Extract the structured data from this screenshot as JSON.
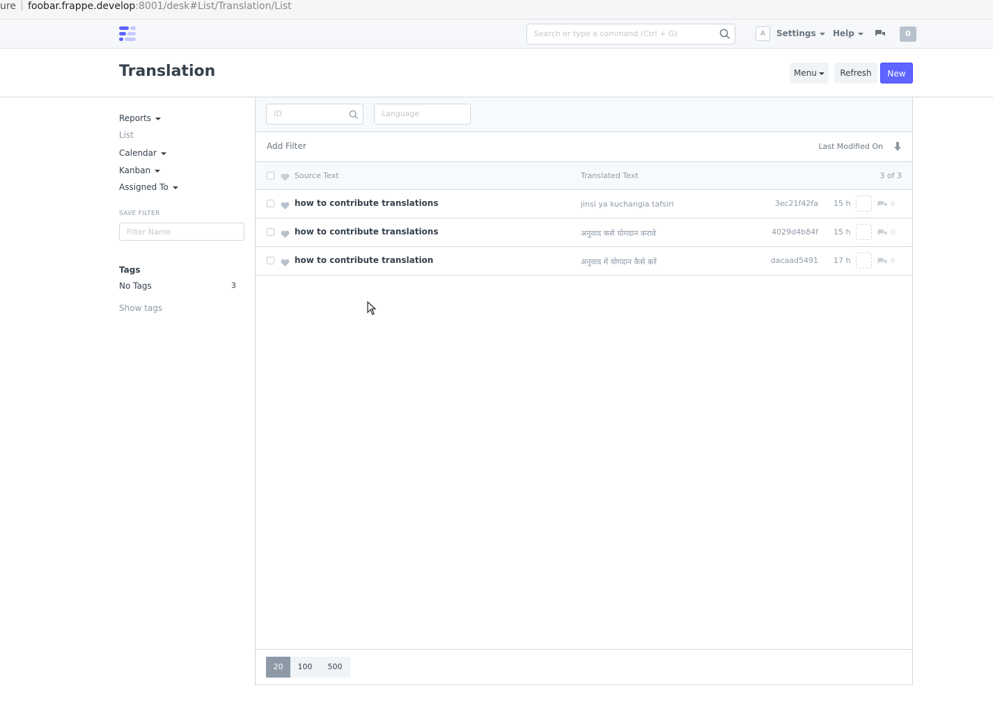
{
  "browser": {
    "url_prefix": "ure",
    "url_host": "foobar.frappe.develop",
    "url_path": ":8001/desk#List/Translation/List"
  },
  "navbar": {
    "search_placeholder": "Search or type a command (Ctrl + G)",
    "avatar_letter": "A",
    "settings_label": "Settings",
    "help_label": "Help",
    "notification_count": "0"
  },
  "page": {
    "title": "Translation",
    "menu_label": "Menu",
    "refresh_label": "Refresh",
    "new_label": "New"
  },
  "sidebar": {
    "items": [
      {
        "label": "Reports",
        "dropdown": true
      },
      {
        "label": "List",
        "dropdown": false
      },
      {
        "label": "Calendar",
        "dropdown": true
      },
      {
        "label": "Kanban",
        "dropdown": true
      },
      {
        "label": "Assigned To",
        "dropdown": true
      }
    ],
    "save_filter_label": "SAVE FILTER",
    "filter_name_placeholder": "Filter Name",
    "tags_heading": "Tags",
    "no_tags_label": "No Tags",
    "no_tags_count": "3",
    "show_tags_label": "Show tags"
  },
  "list": {
    "filters": {
      "id_placeholder": "ID",
      "language_placeholder": "Language"
    },
    "add_filter_label": "Add Filter",
    "sort_label": "Last Modified On",
    "header": {
      "source_text": "Source Text",
      "translated_text": "Translated Text",
      "count": "3 of 3"
    },
    "rows": [
      {
        "source": "how to contribute translations",
        "translated": "jinsi ya kuchangia tafsiri",
        "name": "3ec21f42fa",
        "modified": "15 h",
        "comments": "0"
      },
      {
        "source": "how to contribute translations",
        "translated": "अनुवाद कसे योगदान करावे",
        "name": "4029d4b84f",
        "modified": "15 h",
        "comments": "0"
      },
      {
        "source": "how to contribute translation",
        "translated": "अनुवाद में योगदान कैसे करें",
        "name": "dacaad5491",
        "modified": "17 h",
        "comments": "0"
      }
    ],
    "paging": [
      "20",
      "100",
      "500"
    ]
  },
  "colors": {
    "primary": "#5e64ff",
    "text": "#36414c",
    "muted": "#8d99a6",
    "border": "#d1d8dd"
  }
}
